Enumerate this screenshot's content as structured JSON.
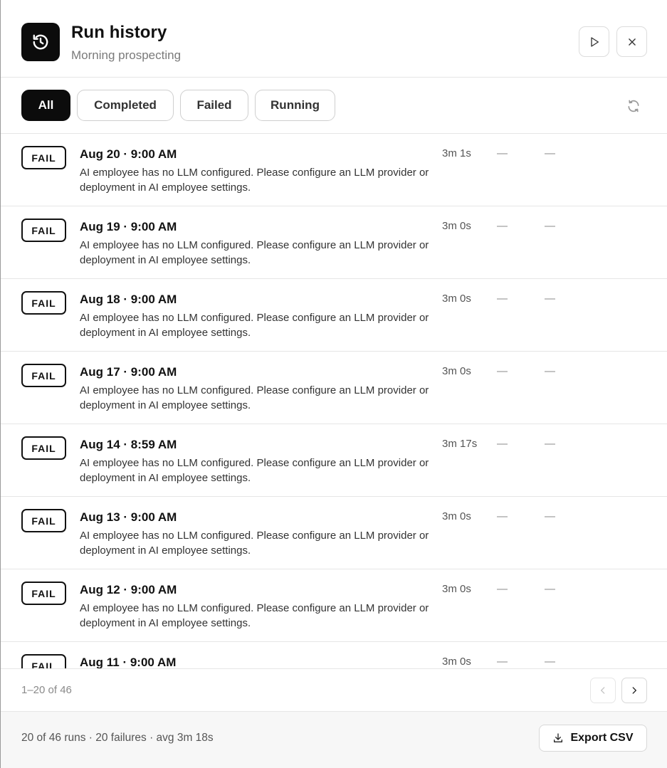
{
  "header": {
    "title": "Run history",
    "subtitle": "Morning prospecting",
    "app_icon": "history-icon",
    "run_icon": "play-icon",
    "close_icon": "close-icon"
  },
  "filters": {
    "tabs": [
      {
        "label": "All",
        "active": true
      },
      {
        "label": "Completed",
        "active": false
      },
      {
        "label": "Failed",
        "active": false
      },
      {
        "label": "Running",
        "active": false
      }
    ],
    "refresh_icon": "refresh-icon"
  },
  "runs": [
    {
      "status": "FAIL",
      "date": "Aug 20 · 9:00 AM",
      "message": "AI employee has no LLM configured. Please configure an LLM provider or deployment in AI employee settings.",
      "duration": "3m 1s",
      "col1": "—",
      "col2": "—"
    },
    {
      "status": "FAIL",
      "date": "Aug 19 · 9:00 AM",
      "message": "AI employee has no LLM configured. Please configure an LLM provider or deployment in AI employee settings.",
      "duration": "3m 0s",
      "col1": "—",
      "col2": "—"
    },
    {
      "status": "FAIL",
      "date": "Aug 18 · 9:00 AM",
      "message": "AI employee has no LLM configured. Please configure an LLM provider or deployment in AI employee settings.",
      "duration": "3m 0s",
      "col1": "—",
      "col2": "—"
    },
    {
      "status": "FAIL",
      "date": "Aug 17 · 9:00 AM",
      "message": "AI employee has no LLM configured. Please configure an LLM provider or deployment in AI employee settings.",
      "duration": "3m 0s",
      "col1": "—",
      "col2": "—"
    },
    {
      "status": "FAIL",
      "date": "Aug 14 · 8:59 AM",
      "message": "AI employee has no LLM configured. Please configure an LLM provider or deployment in AI employee settings.",
      "duration": "3m 17s",
      "col1": "—",
      "col2": "—"
    },
    {
      "status": "FAIL",
      "date": "Aug 13 · 9:00 AM",
      "message": "AI employee has no LLM configured. Please configure an LLM provider or deployment in AI employee settings.",
      "duration": "3m 0s",
      "col1": "—",
      "col2": "—"
    },
    {
      "status": "FAIL",
      "date": "Aug 12 · 9:00 AM",
      "message": "AI employee has no LLM configured. Please configure an LLM provider or deployment in AI employee settings.",
      "duration": "3m 0s",
      "col1": "—",
      "col2": "—"
    },
    {
      "status": "FAIL",
      "date": "Aug 11 · 9:00 AM",
      "message": "",
      "duration": "3m 0s",
      "col1": "—",
      "col2": "—"
    }
  ],
  "pagination": {
    "range": "1–20 of 46",
    "prev_icon": "chevron-left-icon",
    "next_icon": "chevron-right-icon"
  },
  "footer": {
    "summary": "20 of 46 runs · 20 failures · avg 3m 18s",
    "export_label": "Export CSV",
    "export_icon": "download-icon"
  }
}
